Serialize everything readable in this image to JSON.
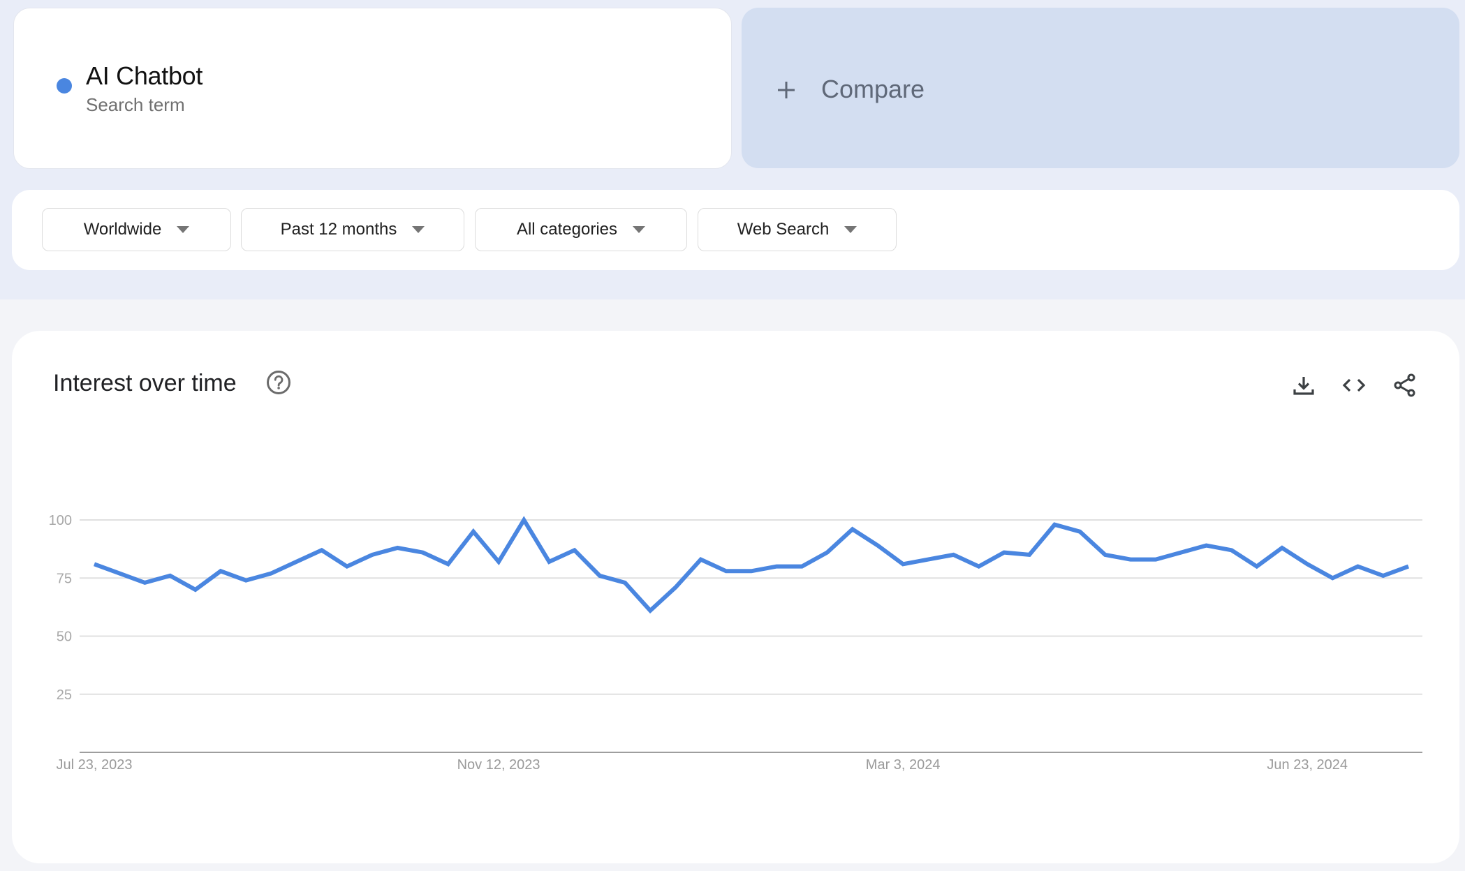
{
  "search_term": {
    "name": "AI Chatbot",
    "subtitle": "Search term",
    "color": "#4a86e0"
  },
  "compare": {
    "icon": "plus-icon",
    "label": "Compare"
  },
  "filters": [
    {
      "label": "Worldwide",
      "icon": "caret-down-icon"
    },
    {
      "label": "Past 12 months",
      "icon": "caret-down-icon"
    },
    {
      "label": "All categories",
      "icon": "caret-down-icon"
    },
    {
      "label": "Web Search",
      "icon": "caret-down-icon"
    }
  ],
  "chart_card": {
    "title": "Interest over time",
    "help_icon": "help-circle-icon",
    "tools": [
      {
        "name": "download",
        "icon": "download-icon"
      },
      {
        "name": "embed",
        "icon": "code-icon"
      },
      {
        "name": "share",
        "icon": "share-icon"
      }
    ]
  },
  "chart_data": {
    "type": "line",
    "title": "Interest over time",
    "xlabel": "",
    "ylabel": "",
    "ylim": [
      0,
      100
    ],
    "yticks": [
      25,
      50,
      75,
      100
    ],
    "grid": true,
    "legend": "none",
    "x_tick_labels": [
      {
        "label": "Jul 23, 2023",
        "index": 0
      },
      {
        "label": "Nov 12, 2023",
        "index": 16
      },
      {
        "label": "Mar 3, 2024",
        "index": 32
      },
      {
        "label": "Jun 23, 2024",
        "index": 48
      }
    ],
    "series": [
      {
        "name": "AI Chatbot",
        "color": "#4a86e0",
        "values": [
          81,
          77,
          73,
          76,
          70,
          78,
          74,
          77,
          82,
          87,
          80,
          85,
          88,
          86,
          81,
          95,
          82,
          100,
          82,
          87,
          76,
          73,
          61,
          71,
          83,
          78,
          78,
          80,
          80,
          86,
          96,
          89,
          81,
          83,
          85,
          80,
          86,
          85,
          98,
          95,
          85,
          83,
          83,
          86,
          89,
          87,
          80,
          88,
          81,
          75,
          80,
          76,
          80
        ]
      }
    ]
  }
}
